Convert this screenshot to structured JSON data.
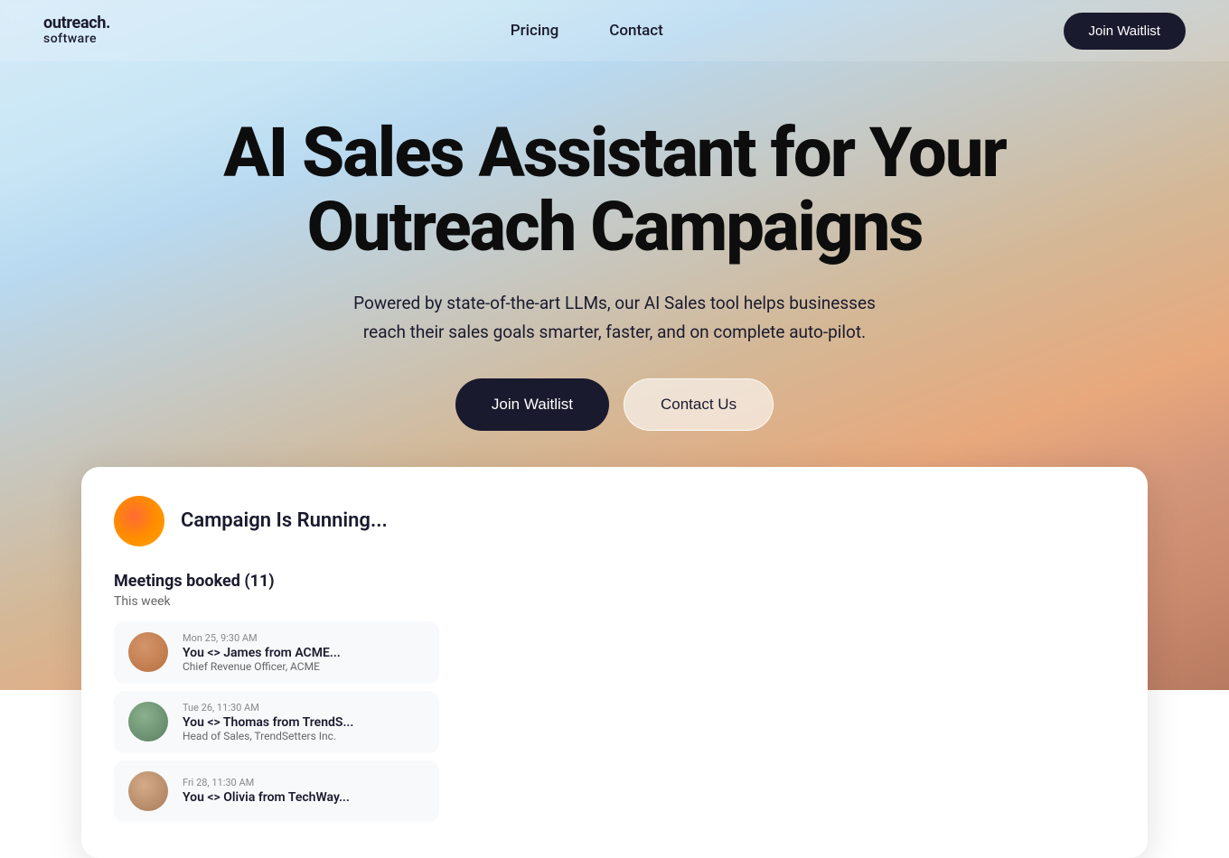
{
  "logo": {
    "main": "outreach.",
    "sub": "software"
  },
  "nav": {
    "links": [
      {
        "label": "Pricing",
        "id": "pricing"
      },
      {
        "label": "Contact",
        "id": "contact"
      }
    ],
    "cta_label": "Join Waitlist"
  },
  "hero": {
    "title": "AI Sales Assistant for Your Outreach Campaigns",
    "subtitle": "Powered by state-of-the-art LLMs, our AI Sales tool helps businesses reach their sales goals smarter, faster, and on complete auto-pilot.",
    "btn_primary": "Join Waitlist",
    "btn_secondary": "Contact Us"
  },
  "card": {
    "campaign_title": "Campaign Is Running...",
    "meetings_title": "Meetings booked (11)",
    "meetings_week": "This week",
    "meetings": [
      {
        "time": "Mon 25, 9:30 AM",
        "name": "You <> James from ACME...",
        "role": "Chief Revenue Officer, ACME",
        "avatar_color": "#c0845a"
      },
      {
        "time": "Tue 26, 11:30 AM",
        "name": "You <> Thomas from TrendS...",
        "role": "Head of Sales, TrendSetters Inc.",
        "avatar_color": "#7a9e7e"
      },
      {
        "time": "Fri 28, 11:30 AM",
        "name": "You <> Olivia from TechWay...",
        "role": "",
        "avatar_color": "#c09a7a"
      }
    ]
  }
}
